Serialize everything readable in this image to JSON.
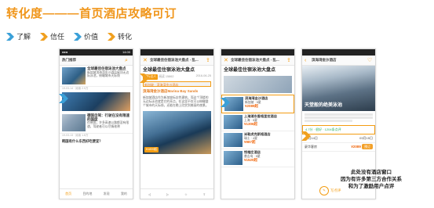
{
  "title": "转化度———首页酒店攻略可订",
  "legend": [
    {
      "label": "了解",
      "color": "#3aa0d8"
    },
    {
      "label": "信任",
      "color": "#f0a020"
    },
    {
      "label": "价值",
      "color": "#3aa0d8"
    },
    {
      "label": "转化",
      "color": "#f0a020"
    }
  ],
  "phone1": {
    "status_left": "●●●",
    "status_right": "14:00",
    "app_title": "热门推荐",
    "article_title": "全球最佳住宿泳池大盘点",
    "items": [
      {
        "title": "全球最佳住宿泳池大盘点",
        "desc": "新加坡滨海湾金沙酒店屋顶无边际泳池，俯瞰城市天际线",
        "meta": "19-03-14 · 阅读 2.5万"
      },
      {
        "title": "德国自驾：行驶在没有限速的国度",
        "desc": "在德国，许多高速公路都没有限速，驾驶者可以尽情驰骋",
        "meta": "19-03-13 · 阅读 1.8万"
      }
    ],
    "bottom_question": "韩国有什么东西好吃便宜？",
    "tabs": [
      "首页",
      "目的地",
      "发现",
      "我的"
    ]
  },
  "phone2": {
    "app_title": "全球最佳住宿泳池大盘点 - 乱...",
    "article_title": "全球最佳住宿泳池大盘点",
    "author": "旅行达人",
    "views": "阅读 15862",
    "date": "2016-06-25",
    "hotel_banner": "新加坡 · 滨海湾金沙酒店",
    "hotel_sub": "滨海湾金沙酒店Marina Bay Sands",
    "para": "新加坡酒店作为新加坡标志性建筑，而这个顶楼的无边际泳池就是它的亮点，在这里不仅可以俯瞰整个城市的天际线，还能在晚上欣赏到美丽的夜景。",
    "price_tag": "¥1899起",
    "tab_icons": [
      "◁",
      "▷",
      "☆",
      "⇪"
    ]
  },
  "phone3": {
    "app_title": "全球最佳住宿泳池大盘点 - 乱...",
    "article_title": "全球最佳住宿泳池大盘点",
    "hotels": [
      {
        "name": "滨海湾金沙酒店",
        "tag": "新加坡 · 5星",
        "price": "¥2089起"
      },
      {
        "name": "上海浦东香格里拉酒店",
        "tag": "上海 · 5星",
        "price": "¥1306起"
      },
      {
        "name": "米勒虎克斯格酒店",
        "tag": "瑞士 · 4星",
        "price": "¥987起"
      },
      {
        "name": "悦榕庄酒店",
        "tag": "普吉岛 · 5星",
        "price": "¥1520起"
      }
    ]
  },
  "phone4": {
    "app_title": "滨海湾金沙酒店",
    "image_caption": "天堂般的绝美泳池",
    "rating": "4.7分 · 很好 · 1204条点评",
    "checkin": "03月14日",
    "checkout": "03月15日",
    "room": "豪华客房",
    "room_price": "¥2089",
    "book_label": "预订",
    "bottom_button": "写点评"
  },
  "caption": [
    "此处没有酒店窗口",
    "因为有许多第三方合作关系",
    "和为了激励用户点评"
  ]
}
